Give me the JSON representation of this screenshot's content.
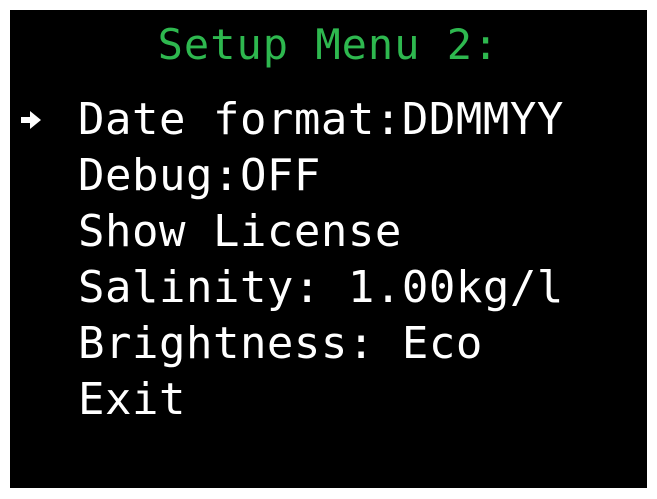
{
  "colors": {
    "background": "#000000",
    "title": "#2eb84f",
    "item": "#ffffff",
    "cursor": "#ffffff"
  },
  "title": "Setup Menu 2:",
  "cursor_icon": "right-arrow-icon",
  "selected_index": 0,
  "menu": {
    "items": [
      {
        "label": "Date format:DDMMYY"
      },
      {
        "label": "Debug:OFF"
      },
      {
        "label": "Show License"
      },
      {
        "label": "Salinity: 1.00kg/l"
      },
      {
        "label": "Brightness: Eco"
      },
      {
        "label": "Exit"
      }
    ]
  }
}
